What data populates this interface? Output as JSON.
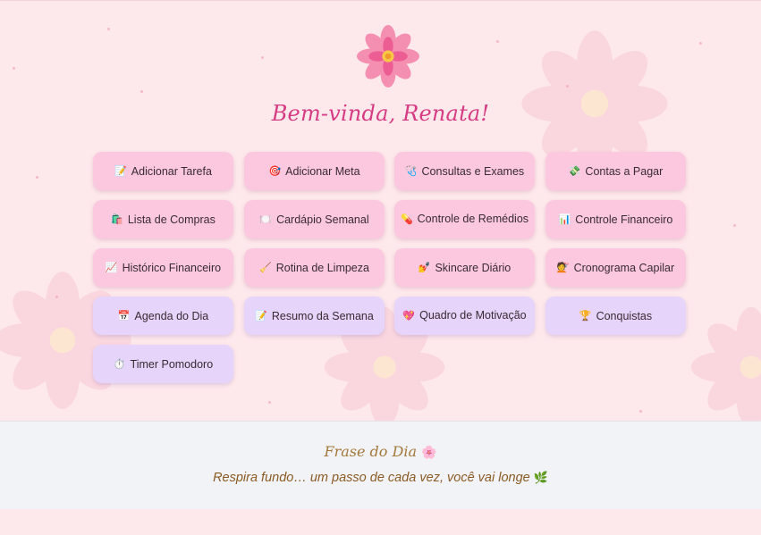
{
  "greeting": "Bem-vinda, Renata!",
  "buttons": [
    {
      "icon": "📝",
      "label": "Adicionar Tarefa"
    },
    {
      "icon": "🎯",
      "label": "Adicionar Meta"
    },
    {
      "icon": "🩺",
      "label": "Consultas e Exames"
    },
    {
      "icon": "💸",
      "label": "Contas a Pagar"
    },
    {
      "icon": "🛍️",
      "label": "Lista de Compras"
    },
    {
      "icon": "🍽️",
      "label": "Cardápio Semanal"
    },
    {
      "icon": "💊",
      "label": "Controle de Remédios"
    },
    {
      "icon": "📊",
      "label": "Controle Financeiro"
    },
    {
      "icon": "📈",
      "label": "Histórico Financeiro"
    },
    {
      "icon": "🧹",
      "label": "Rotina de Limpeza"
    },
    {
      "icon": "💅",
      "label": "Skincare Diário"
    },
    {
      "icon": "💇",
      "label": "Cronograma Capilar"
    },
    {
      "icon": "📅",
      "label": "Agenda do Dia"
    },
    {
      "icon": "📝",
      "label": "Resumo da Semana"
    },
    {
      "icon": "💖",
      "label": "Quadro de Motivação"
    },
    {
      "icon": "🏆",
      "label": "Conquistas"
    },
    {
      "icon": "⏱️",
      "label": "Timer Pomodoro"
    }
  ],
  "quote": {
    "title": "Frase do Dia",
    "title_icon": "🌸",
    "text": "Respira fundo… um passo de cada vez, você vai longe",
    "text_icon": "🌿"
  },
  "colors": {
    "accent": "#d63c83",
    "button_pink": "#fbc8e0",
    "button_lilac": "#e7d4fb",
    "quote_gold": "#a3783a"
  }
}
